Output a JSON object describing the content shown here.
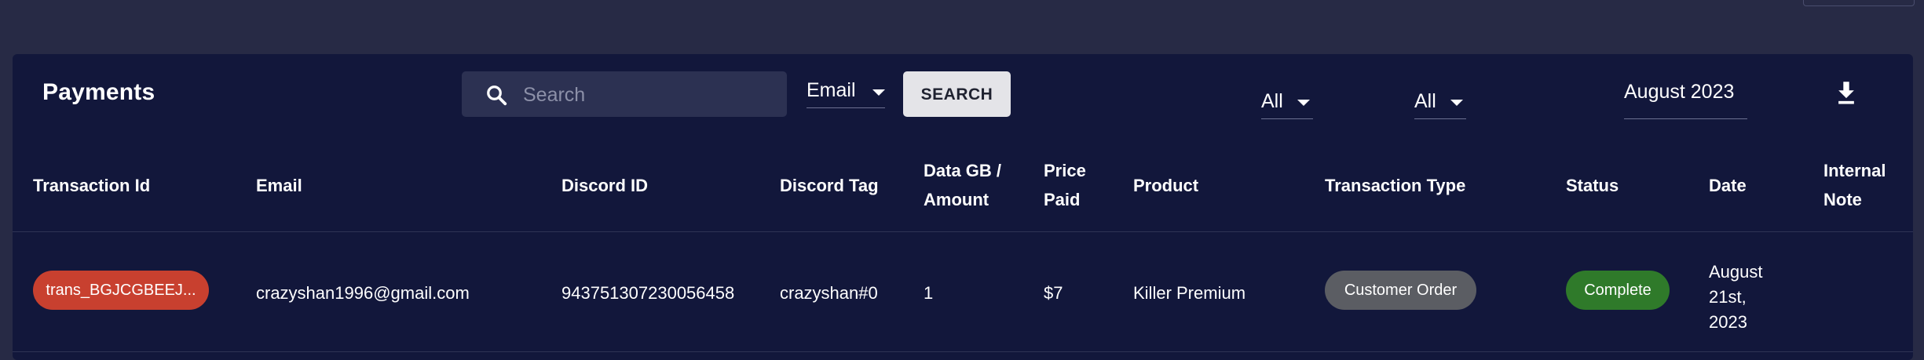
{
  "header": {
    "title": "Payments"
  },
  "search": {
    "placeholder": "Search",
    "value": "",
    "field_select": "Email",
    "button_label": "SEARCH"
  },
  "filters": {
    "filter_1": "All",
    "filter_2": "All",
    "month": "August 2023"
  },
  "icons": {
    "search": "search-icon",
    "download": "download-icon",
    "dropdown": "caret-down-icon"
  },
  "table": {
    "columns": [
      "Transaction Id",
      "Email",
      "Discord ID",
      "Discord Tag",
      "Data GB / Amount",
      "Price Paid",
      "Product",
      "Transaction Type",
      "Status",
      "Date",
      "Internal Note"
    ],
    "column_lines": [
      [
        "Transaction Id"
      ],
      [
        "Email"
      ],
      [
        "Discord ID"
      ],
      [
        "Discord Tag"
      ],
      [
        "Data GB /",
        "Amount"
      ],
      [
        "Price",
        "Paid"
      ],
      [
        "Product"
      ],
      [
        "Transaction Type"
      ],
      [
        "Status"
      ],
      [
        "Date"
      ],
      [
        "Internal",
        "Note"
      ]
    ],
    "rows": [
      {
        "transaction_id": "trans_BGJCGBEEJ...",
        "email": "crazyshan1996@gmail.com",
        "discord_id": "943751307230056458",
        "discord_tag": "crazyshan#0",
        "data_amount": "1",
        "price_paid": "$7",
        "product": "Killer Premium",
        "transaction_type": "Customer Order",
        "status": "Complete",
        "date": "August 21st, 2023",
        "date_lines": [
          "August",
          "21st,",
          "2023"
        ],
        "internal_note": ""
      }
    ]
  },
  "colors": {
    "background": "#272a45",
    "card": "#12173b",
    "transaction_pill": "#c8402f",
    "type_pill": "#5b5d63",
    "status_complete": "#2f7a2a",
    "search_button": "#e4e4e8"
  }
}
